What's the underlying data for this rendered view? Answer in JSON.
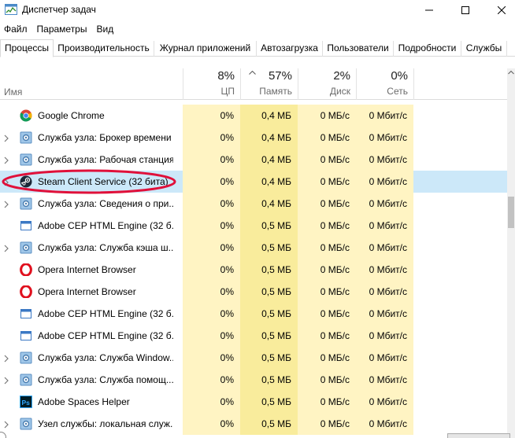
{
  "window": {
    "title": "Диспетчер задач",
    "minimize_icon": "minimize-icon",
    "maximize_icon": "maximize-icon",
    "close_icon": "close-icon"
  },
  "menu": [
    "Файл",
    "Параметры",
    "Вид"
  ],
  "tabs": [
    {
      "label": "Процессы",
      "active": true
    },
    {
      "label": "Производительность"
    },
    {
      "label": "Журнал приложений"
    },
    {
      "label": "Автозагрузка"
    },
    {
      "label": "Пользователи"
    },
    {
      "label": "Подробности"
    },
    {
      "label": "Службы"
    }
  ],
  "columns": {
    "name": {
      "label": "Имя"
    },
    "cpu": {
      "pct": "8%",
      "label": "ЦП"
    },
    "memory": {
      "pct": "57%",
      "label": "Память",
      "sorted": "ascending"
    },
    "disk": {
      "pct": "2%",
      "label": "Диск"
    },
    "network": {
      "pct": "0%",
      "label": "Сеть"
    }
  },
  "processes": [
    {
      "name": "Google Chrome",
      "icon": "chrome-icon",
      "expandable": false,
      "cpu": "0%",
      "memory": "0,4 МБ",
      "disk": "0 МБ/с",
      "network": "0 Мбит/с"
    },
    {
      "name": "Служба узла: Брокер времени",
      "icon": "gear-icon",
      "expandable": true,
      "cpu": "0%",
      "memory": "0,4 МБ",
      "disk": "0 МБ/с",
      "network": "0 Мбит/с"
    },
    {
      "name": "Служба узла: Рабочая станция",
      "icon": "gear-icon",
      "expandable": true,
      "cpu": "0%",
      "memory": "0,4 МБ",
      "disk": "0 МБ/с",
      "network": "0 Мбит/с"
    },
    {
      "name": "Steam Client Service (32 бита)",
      "icon": "steam-icon",
      "expandable": true,
      "selected": true,
      "cpu": "0%",
      "memory": "0,4 МБ",
      "disk": "0 МБ/с",
      "network": "0 Мбит/с"
    },
    {
      "name": "Служба узла: Сведения о при...",
      "icon": "gear-icon",
      "expandable": true,
      "cpu": "0%",
      "memory": "0,4 МБ",
      "disk": "0 МБ/с",
      "network": "0 Мбит/с"
    },
    {
      "name": "Adobe CEP HTML Engine (32 б...",
      "icon": "window-icon",
      "expandable": false,
      "cpu": "0%",
      "memory": "0,5 МБ",
      "disk": "0 МБ/с",
      "network": "0 Мбит/с"
    },
    {
      "name": "Служба узла: Служба кэша ш...",
      "icon": "gear-icon",
      "expandable": true,
      "cpu": "0%",
      "memory": "0,5 МБ",
      "disk": "0 МБ/с",
      "network": "0 Мбит/с"
    },
    {
      "name": "Opera Internet Browser",
      "icon": "opera-icon",
      "expandable": false,
      "cpu": "0%",
      "memory": "0,5 МБ",
      "disk": "0 МБ/с",
      "network": "0 Мбит/с"
    },
    {
      "name": "Opera Internet Browser",
      "icon": "opera-icon",
      "expandable": false,
      "cpu": "0%",
      "memory": "0,5 МБ",
      "disk": "0 МБ/с",
      "network": "0 Мбит/с"
    },
    {
      "name": "Adobe CEP HTML Engine (32 б...",
      "icon": "window-icon",
      "expandable": false,
      "cpu": "0%",
      "memory": "0,5 МБ",
      "disk": "0 МБ/с",
      "network": "0 Мбит/с"
    },
    {
      "name": "Adobe CEP HTML Engine (32 б...",
      "icon": "window-icon",
      "expandable": false,
      "cpu": "0%",
      "memory": "0,5 МБ",
      "disk": "0 МБ/с",
      "network": "0 Мбит/с"
    },
    {
      "name": "Служба узла: Служба Window...",
      "icon": "gear-icon",
      "expandable": true,
      "cpu": "0%",
      "memory": "0,5 МБ",
      "disk": "0 МБ/с",
      "network": "0 Мбит/с"
    },
    {
      "name": "Служба узла: Служба помощ...",
      "icon": "gear-icon",
      "expandable": true,
      "cpu": "0%",
      "memory": "0,5 МБ",
      "disk": "0 МБ/с",
      "network": "0 Мбит/с"
    },
    {
      "name": "Adobe Spaces Helper",
      "icon": "photoshop-icon",
      "expandable": false,
      "cpu": "0%",
      "memory": "0,5 МБ",
      "disk": "0 МБ/с",
      "network": "0 Мбит/с"
    },
    {
      "name": "Узел службы: локальная служ...",
      "icon": "gear-icon",
      "expandable": true,
      "cpu": "0%",
      "memory": "0,5 МБ",
      "disk": "0 МБ/с",
      "network": "0 Мбит/с"
    }
  ],
  "colors": {
    "cpu_column": "#fff4c3",
    "memory_column": "#f9ec9c",
    "selected_row": "#cce8f9",
    "annotation": "#e0103a"
  }
}
